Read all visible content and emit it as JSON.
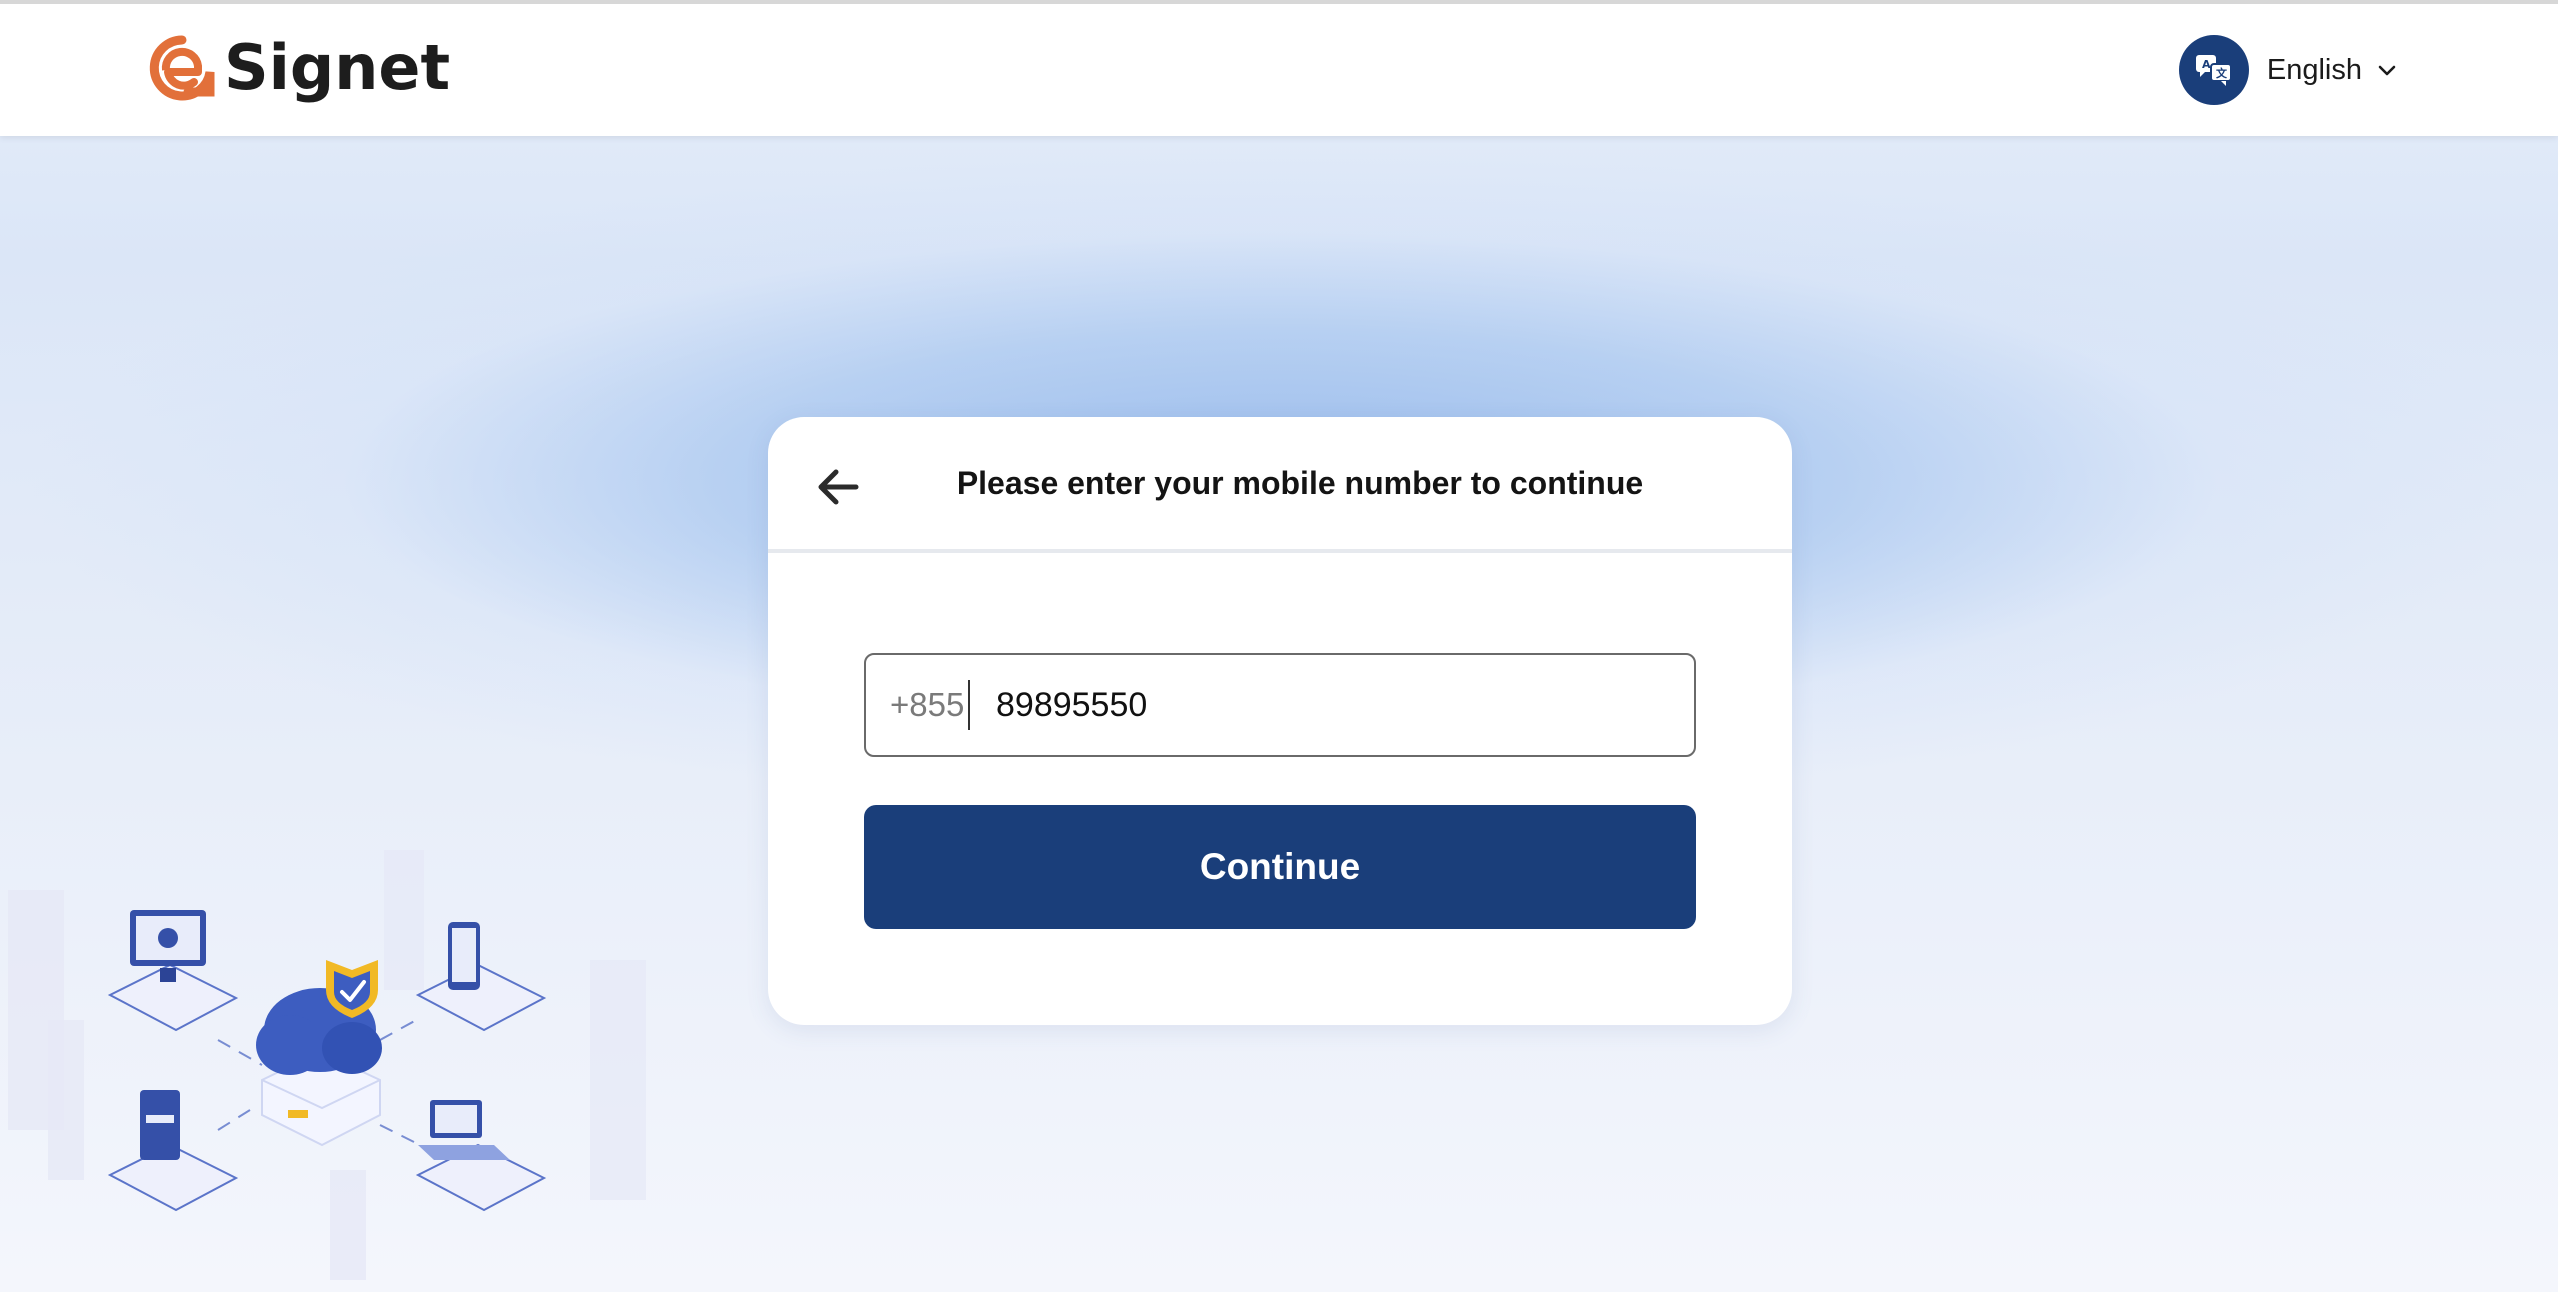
{
  "header": {
    "brand_name": "Signet",
    "brand_color": "#e2703a",
    "language": {
      "icon": "translate-icon",
      "label": "English"
    }
  },
  "card": {
    "title": "Please enter your mobile number to continue",
    "back_icon": "arrow-left-icon",
    "phone": {
      "country_code": "+855",
      "value": "89895550"
    },
    "continue_label": "Continue"
  },
  "colors": {
    "primary": "#1a3e7a",
    "accent": "#e2703a"
  },
  "illustration": {
    "icon": "cloud-security-devices-illustration"
  }
}
